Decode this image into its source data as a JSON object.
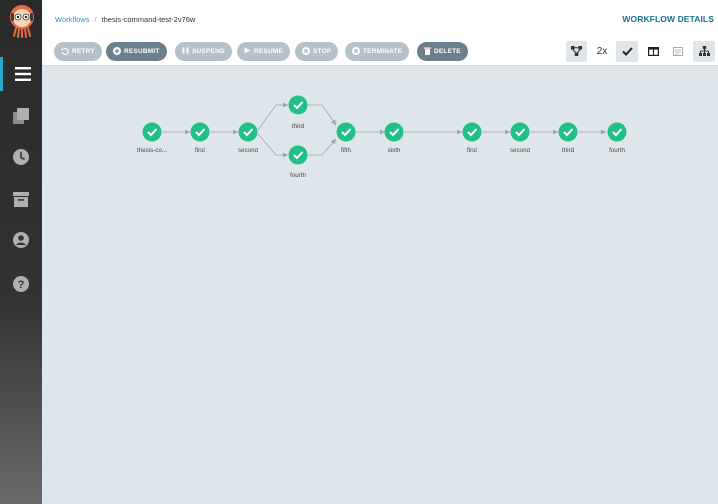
{
  "breadcrumb": {
    "root": "Workflows",
    "current": "thesis-command-test-2v76w"
  },
  "page_title": "WORKFLOW DETAILS",
  "toolbar": {
    "retry": "RETRY",
    "resubmit": "RESUBMIT",
    "suspend": "SUSPEND",
    "resume": "RESUME",
    "stop": "STOP",
    "terminate": "TERMINATE",
    "delete": "DELETE",
    "zoom": "2x"
  },
  "graph": {
    "nodes": [
      {
        "label": "thesis-co...",
        "status": "succeeded"
      },
      {
        "label": "first",
        "status": "succeeded"
      },
      {
        "label": "second",
        "status": "succeeded"
      },
      {
        "label": "third",
        "status": "succeeded"
      },
      {
        "label": "fourth",
        "status": "succeeded"
      },
      {
        "label": "fifth",
        "status": "succeeded"
      },
      {
        "label": "sixth",
        "status": "succeeded"
      },
      {
        "label": "first",
        "status": "succeeded"
      },
      {
        "label": "second",
        "status": "succeeded"
      },
      {
        "label": "third",
        "status": "succeeded"
      },
      {
        "label": "fourth",
        "status": "succeeded"
      }
    ]
  },
  "colors": {
    "success": "#20c088",
    "accent": "#2aa6c7",
    "title": "#17718f",
    "canvas": "#dee6eb",
    "edge": "#9aa6ad"
  },
  "icons": {
    "logo": "argo-octopus-logo",
    "nav": [
      "workflows-icon",
      "templates-icon",
      "cron-icon",
      "archive-icon",
      "user-icon",
      "help-icon"
    ]
  }
}
